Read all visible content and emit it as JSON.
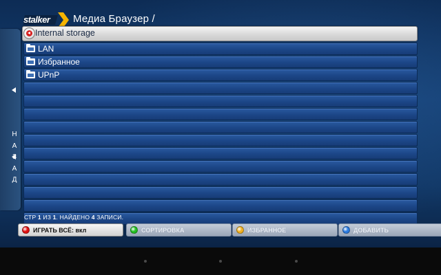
{
  "header": {
    "logo_text": "stalker",
    "title": "Медиа Браузер /"
  },
  "back_panel": {
    "letters": [
      "Н",
      "А",
      "З",
      "А",
      "Д"
    ]
  },
  "list": {
    "items": [
      {
        "label": "Internal storage",
        "icon": "storage-back-icon",
        "selected": true
      },
      {
        "label": "LAN",
        "icon": "folder-icon"
      },
      {
        "label": "Избранное",
        "icon": "folder-icon"
      },
      {
        "label": "UPnP",
        "icon": "folder-icon"
      }
    ],
    "empty_rows": 11
  },
  "status": {
    "page_prefix": "СТР",
    "page_current": "1",
    "of_word": "ИЗ",
    "page_total": "1",
    "found_word": ". НАЙДЕНО",
    "found_count": "4",
    "records_word": "ЗАПИСИ."
  },
  "buttons": [
    {
      "label": "ИГРАТЬ ВСЁ: вкл",
      "color": "#e01010",
      "name": "play-all-button"
    },
    {
      "label": "СОРТИРОВКА",
      "color": "#22c020",
      "name": "sort-button"
    },
    {
      "label": "ИЗБРАННОЕ",
      "color": "#f0b020",
      "name": "favorites-button"
    },
    {
      "label": "ДОБАВИТЬ",
      "color": "#2a7ae0",
      "name": "add-button"
    }
  ],
  "colors": {
    "row_blue": "#1c4687",
    "selected_row": "#d9d9d9",
    "background": "#143f73"
  }
}
